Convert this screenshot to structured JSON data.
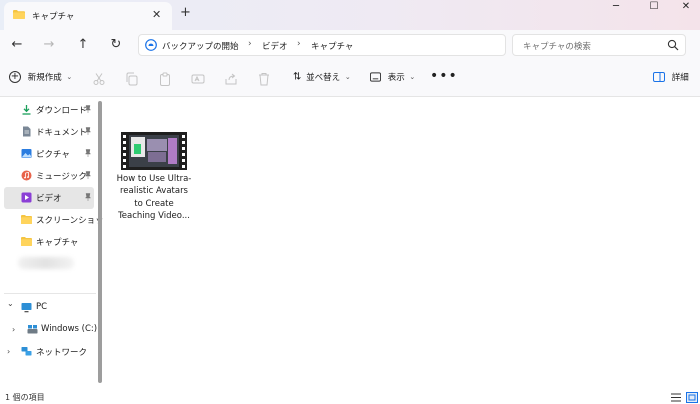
{
  "window": {
    "tab_title": "キャプチャ",
    "tab_close": "✕",
    "new_tab": "+",
    "minimize": "─",
    "maximize": "☐",
    "close": "✕"
  },
  "address": {
    "back": "←",
    "forward": "→",
    "up": "↑",
    "refresh": "↻",
    "sep": "›",
    "breadcrumbs": [
      "バックアップの開始",
      "ビデオ",
      "キャプチャ"
    ],
    "search_placeholder": "キャプチャの検索"
  },
  "toolbar": {
    "new_label": "新規作成",
    "sort_label": "並べ替え",
    "view_label": "表示",
    "more": "•••",
    "details_label": "詳細"
  },
  "sidebar": {
    "quick_access": [
      {
        "label": "ダウンロード",
        "icon": "download-icon",
        "pinned": true
      },
      {
        "label": "ドキュメント",
        "icon": "document-icon",
        "pinned": true
      },
      {
        "label": "ピクチャ",
        "icon": "pictures-icon",
        "pinned": true
      },
      {
        "label": "ミュージック",
        "icon": "music-icon",
        "pinned": true
      },
      {
        "label": "ビデオ",
        "icon": "video-icon",
        "pinned": true,
        "selected": true
      },
      {
        "label": "スクリーンショット",
        "icon": "folder-icon",
        "pinned": false
      },
      {
        "label": "キャプチャ",
        "icon": "folder-icon",
        "pinned": false
      }
    ],
    "pc_label": "PC",
    "drive_label": "Windows (C:)",
    "network_label": "ネットワーク",
    "chevron_down": "⌄",
    "chevron_right": "›"
  },
  "content": {
    "files": [
      {
        "name": "How to Use Ultra-realistic Avatars to Create Teaching Video...",
        "icon": "video-file-thumbnail"
      }
    ]
  },
  "status": {
    "item_count": "1 個の項目"
  },
  "colors": {
    "accent_blue": "#1a73e8",
    "folder_yellow": "#f5c542",
    "selected_bg": "#e6e6e6"
  }
}
